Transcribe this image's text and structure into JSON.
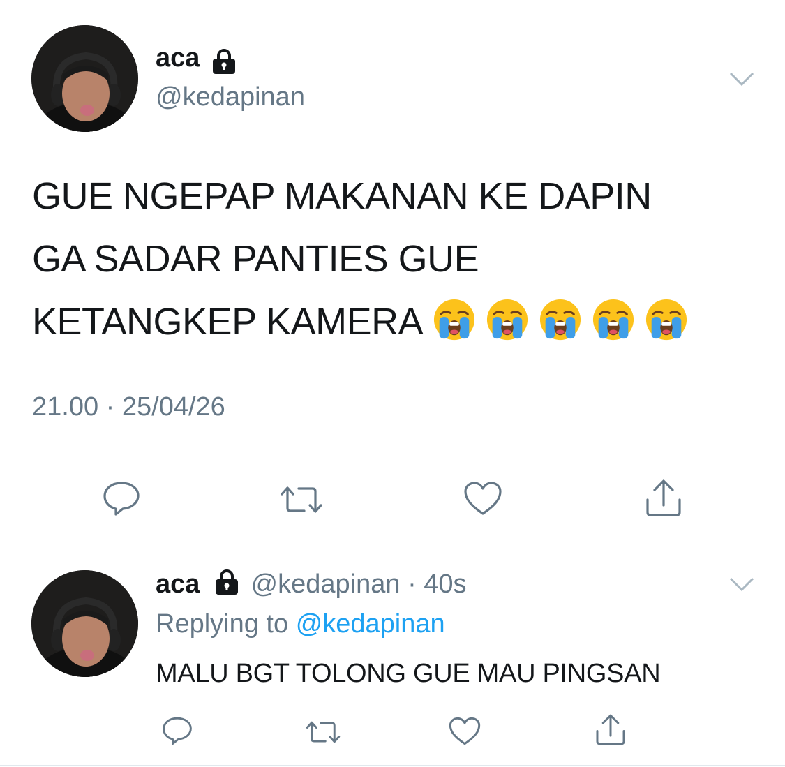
{
  "main_tweet": {
    "author_name": "aca",
    "author_handle": "@kedapinan",
    "lock_icon": "lock-icon",
    "text_lines": [
      "GUE NGEPAP MAKANAN KE DAPIN",
      "GA SADAR PANTIES GUE",
      "KETANGKEP KAMERA"
    ],
    "emoji": [
      "loudly-crying-face",
      "loudly-crying-face",
      "loudly-crying-face",
      "loudly-crying-face",
      "loudly-crying-face"
    ],
    "timestamp": "21.00 · 25/04/26",
    "actions": [
      "reply-icon",
      "retweet-icon",
      "like-icon",
      "share-icon"
    ]
  },
  "reply_tweet": {
    "author_name": "aca",
    "author_handle": "@kedapinan",
    "separator": "·",
    "time_ago": "40s",
    "replying_prefix": "Replying to",
    "replying_handle": "@kedapinan",
    "text": "MALU BGT TOLONG GUE MAU PINGSAN",
    "actions": [
      "reply-icon",
      "retweet-icon",
      "like-icon",
      "share-icon"
    ]
  },
  "colors": {
    "text": "#14171a",
    "secondary": "#657786",
    "link": "#1da1f2",
    "divider": "#e1e8ed"
  }
}
